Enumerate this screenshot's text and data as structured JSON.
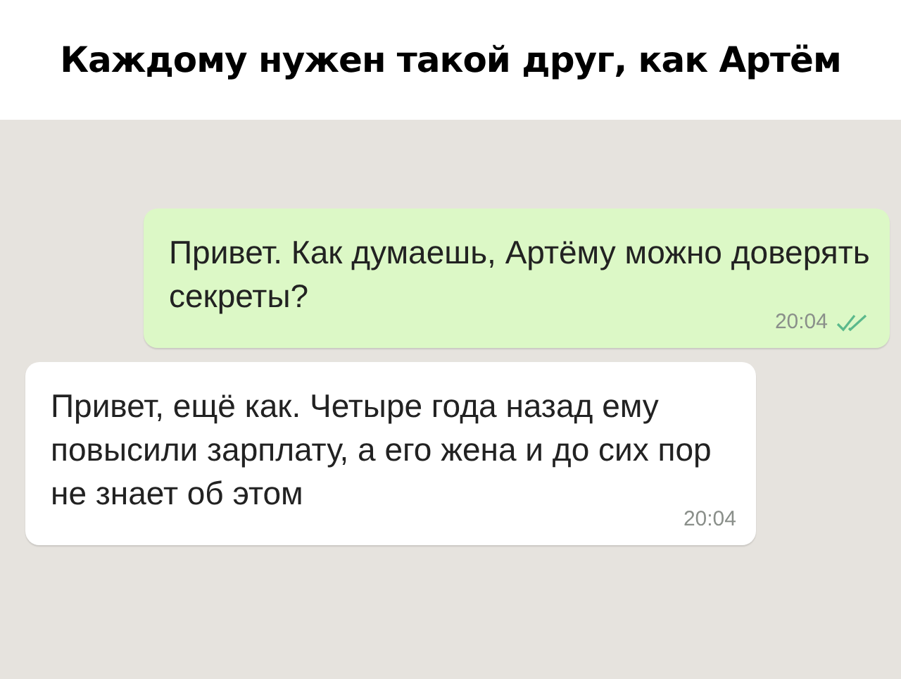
{
  "caption": "Каждому нужен такой друг, как Артём",
  "messages": [
    {
      "kind": "outgoing",
      "text": "Привет. Как думаешь, Артёму можно доверять секреты?",
      "time": "20:04"
    },
    {
      "kind": "incoming",
      "text": "Привет, ещё как. Четыре года назад ему повысили зарплату, а его жена и до сих пор не знает об этом",
      "time": "20:04"
    }
  ]
}
